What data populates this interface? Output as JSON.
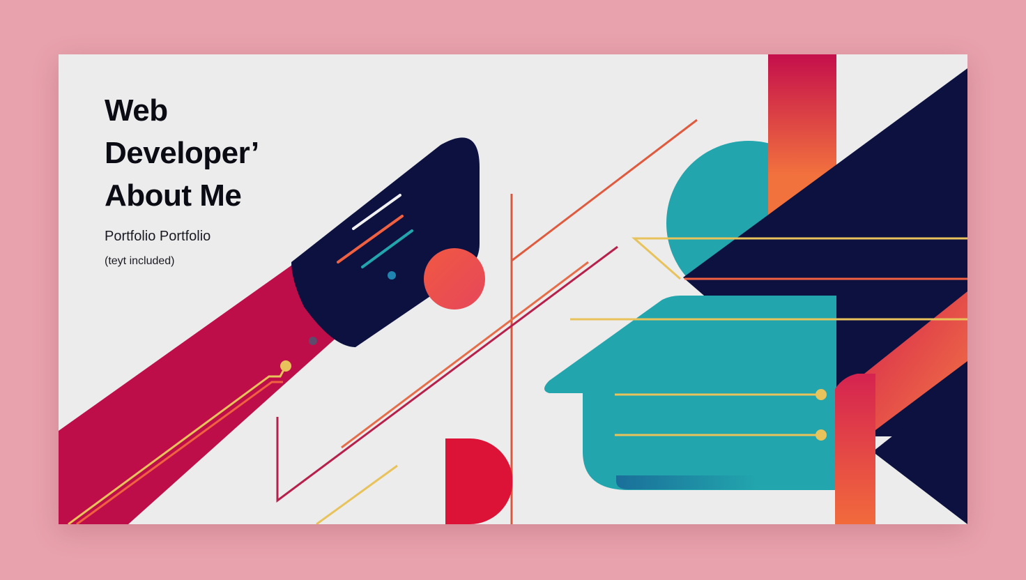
{
  "poster": {
    "title_lines": [
      "Web",
      "Developer’",
      "About Me"
    ],
    "subtitle": "Portfolio Portfolio",
    "note": "(teyt included)"
  },
  "palette": {
    "background": "#e8a2ad",
    "card": "#ececec",
    "navy": "#0c1140",
    "crimson": "#be0e4a",
    "coral": "#ef6140",
    "teal": "#22a5ad",
    "gold": "#e8c25a",
    "red": "#dc1236"
  }
}
